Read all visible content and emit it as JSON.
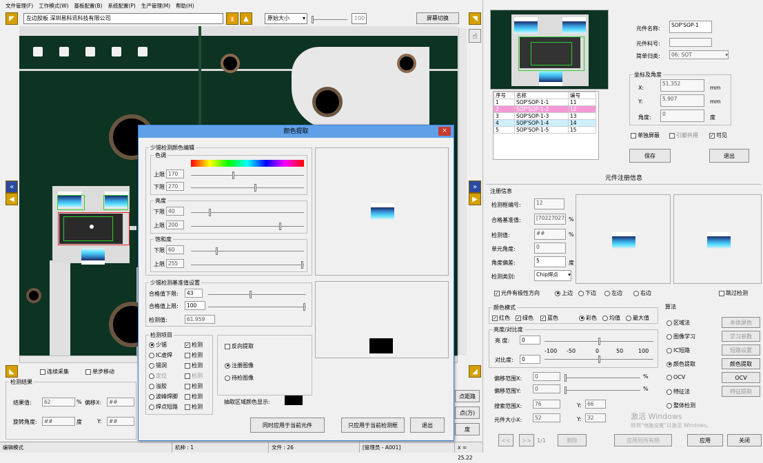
{
  "menu": [
    "文件管理(F)",
    "工作模式(W)",
    "基板配置(B)",
    "系统配置(P)",
    "生产管理(M)",
    "帮助(H)"
  ],
  "toolbar": {
    "board_name": "左边胶板  深圳易科讯科技有限公司",
    "zoom": "原始大小",
    "zoom_value": "100",
    "switch_screen": "屏幕切换"
  },
  "left_bottom": {
    "continuous": "连续采集",
    "single_step": "单步移动",
    "result_group": "检测结果",
    "result_value_label": "结果值:",
    "result_value": "62",
    "percent": "%",
    "offset_x_label": "偏移X:",
    "offset_x": "##",
    "rotation_label": "旋转角度:",
    "rotation": "##",
    "degree": "度",
    "y_label": "Y:",
    "y": "##",
    "fine_btn": "点距路",
    "fine_btn2": "点(万)",
    "deg_btn": "度"
  },
  "statusbar": {
    "mode": "编辑模式",
    "machine": "机种 : 1",
    "file": "文件 : 26",
    "user": "[管理员 - A001]",
    "coord": "x = 25.22"
  },
  "dialog": {
    "title": "颜色提取",
    "close": "×",
    "edit_group": "少锡检测颜色编辑",
    "hue": "色调",
    "hue_upper_label": "上限",
    "hue_upper": "170",
    "hue_lower_label": "下限",
    "hue_lower": "270",
    "brightness": "亮度",
    "bri_lower_label": "下限",
    "bri_lower": "40",
    "bri_upper_label": "上限",
    "bri_upper": "200",
    "saturation": "饱和度",
    "sat_lower_label": "下限",
    "sat_lower": "60",
    "sat_upper_label": "上限",
    "sat_upper": "255",
    "base_group": "少锡检测基准值设置",
    "pass_lower_label": "合格值下限:",
    "pass_lower": "43",
    "pass_upper_label": "合格值上限:",
    "pass_upper": "100",
    "detect_label": "检测值:",
    "detect_value": "61.959",
    "items_group": "检测项目",
    "items": [
      {
        "name": "少锡",
        "radio": true,
        "check": true
      },
      {
        "name": "IC虚焊",
        "radio": false,
        "check": false
      },
      {
        "name": "锡洞",
        "radio": false,
        "check": false
      },
      {
        "name": "定位",
        "radio": false,
        "check": false
      },
      {
        "name": "溢胶",
        "radio": false,
        "check": false
      },
      {
        "name": "波峰焊脚",
        "radio": false,
        "check": false
      },
      {
        "name": "焊点短路",
        "radio": false,
        "check": false
      }
    ],
    "check_word": "检测",
    "reverse": "反向提取",
    "reg_image": "注册图像",
    "wait_image": "待检图像",
    "extract_color_label": "抽取区域颜色显示:",
    "btn_apply_current": "同时应用于当前元件",
    "btn_apply_box": "只应用于当前检测框",
    "btn_exit": "退出"
  },
  "component": {
    "name_label": "元件名称:",
    "name": "SOP'SOP-1",
    "partno_label": "元件料号:",
    "partno": "",
    "category_label": "简单归类:",
    "category": "06: SOT",
    "coord_group": "坐标及角度",
    "x_label": "X:",
    "x": "51.352",
    "mm": "mm",
    "y_label": "Y:",
    "y": "5.907",
    "angle_label": "角度:",
    "angle": "0",
    "degree": "度",
    "single_mask": "单独屏蔽",
    "pin_share": "引脚共用",
    "visible": "可见",
    "save": "保存",
    "exit": "退出",
    "list_headers": [
      "序号",
      "名称",
      "编号"
    ],
    "list_rows": [
      [
        "1",
        "SOP'SOP-1-1",
        "11"
      ],
      [
        "2",
        "SOP'SOP-1-2",
        "12"
      ],
      [
        "3",
        "SOP'SOP-1-3",
        "13"
      ],
      [
        "4",
        "SOP'SOP-1-4",
        "14"
      ],
      [
        "5",
        "SOP'SOP-1-5",
        "15"
      ]
    ]
  },
  "reg": {
    "title": "元件注册信息",
    "info_group": "注册信息",
    "box_no_label": "检测框编号:",
    "box_no": "12",
    "pass_label": "合格基准值:",
    "pass_value": "[70227027:",
    "pct": "%",
    "detect_label": "检测值:",
    "detect": "##",
    "unit_angle_label": "单元角度:",
    "unit_angle": "0",
    "angle_dev_label": "角度偏差:",
    "angle_dev": "5",
    "deg": "度",
    "type_label": "检测类别:",
    "type": "Chip焊点",
    "polarity": "元件有极性方向",
    "dir_up": "上边",
    "dir_down": "下边",
    "dir_left": "左边",
    "dir_right": "右边",
    "skip": "跳过检测",
    "color_group": "颜色模式",
    "red": "红色",
    "green": "绿色",
    "blue": "蓝色",
    "color_mode": "彩色",
    "avg": "均值",
    "max": "最大值",
    "bc_group": "亮度/对比度",
    "brightness_label": "亮 度:",
    "brightness": "0",
    "contrast_label": "对比度:",
    "contrast": "0",
    "scale": [
      "-100",
      "-50",
      "0",
      "50",
      "100"
    ],
    "offx_label": "偏移范围X:",
    "offx": "0",
    "offy_label": "偏移范围Y:",
    "offy": "0",
    "search_x_label": "搜索范围X:",
    "search_x": "76",
    "search_y_label": "Y:",
    "search_y": "66",
    "size_x_label": "元件大小X:",
    "size_x": "52",
    "size_y_label": "Y:",
    "size_y": "32",
    "algo_group": "算法",
    "algos": [
      {
        "name": "区域法",
        "btn": "本体屏色",
        "on": false
      },
      {
        "name": "图像学习",
        "btn": "学习参数",
        "on": false
      },
      {
        "name": "IC短路",
        "btn": "短路设置",
        "on": false
      },
      {
        "name": "颜色提取",
        "btn": "颜色提取",
        "on": true
      },
      {
        "name": "OCV",
        "btn": "OCV",
        "on": false
      },
      {
        "name": "特征法",
        "btn": "特征提取",
        "on": false
      },
      {
        "name": "整体检测",
        "btn": "",
        "on": false
      }
    ],
    "nav_first": "<<",
    "nav_next": ">>",
    "page": "1/1",
    "delete": "删除",
    "apply_all": "应用到所有相",
    "apply": "应用",
    "close": "关闭",
    "watermark1": "激活 Windows",
    "watermark2": "转到\"电脑设置\"以激活 Windows。"
  }
}
